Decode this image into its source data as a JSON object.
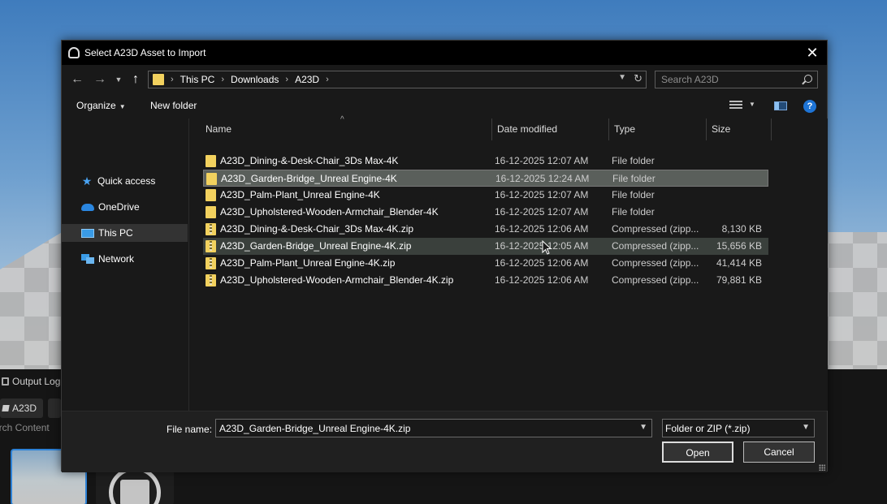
{
  "background": {
    "output_log_tab": "Output Log",
    "content_chip": "A23D",
    "search_hint": "arch Content"
  },
  "dialog": {
    "title": "Select A23D Asset to Import",
    "breadcrumb": [
      "This PC",
      "Downloads",
      "A23D"
    ],
    "search_placeholder": "Search A23D",
    "toolbar": {
      "organize_label": "Organize",
      "new_folder_label": "New folder"
    },
    "nav": [
      {
        "label": "Quick access",
        "icon": "star-icon"
      },
      {
        "label": "OneDrive",
        "icon": "cloud-icon"
      },
      {
        "label": "This PC",
        "icon": "computer-icon"
      },
      {
        "label": "Network",
        "icon": "network-icon"
      }
    ],
    "columns": [
      "Name",
      "Date modified",
      "Type",
      "Size"
    ],
    "files": [
      {
        "name": "A23D_Dining-&-Desk-Chair_3Ds Max-4K",
        "date": "16-12-2025 12:07 AM",
        "type": "File folder",
        "size": "",
        "kind": "folder"
      },
      {
        "name": "A23D_Garden-Bridge_Unreal Engine-4K",
        "date": "16-12-2025 12:24 AM",
        "type": "File folder",
        "size": "",
        "kind": "folder"
      },
      {
        "name": "A23D_Palm-Plant_Unreal Engine-4K",
        "date": "16-12-2025 12:07 AM",
        "type": "File folder",
        "size": "",
        "kind": "folder"
      },
      {
        "name": "A23D_Upholstered-Wooden-Armchair_Blender-4K",
        "date": "16-12-2025 12:07 AM",
        "type": "File folder",
        "size": "",
        "kind": "folder"
      },
      {
        "name": "A23D_Dining-&-Desk-Chair_3Ds Max-4K.zip",
        "date": "16-12-2025 12:06 AM",
        "type": "Compressed (zipp...",
        "size": "8,130 KB",
        "kind": "zip"
      },
      {
        "name": "A23D_Garden-Bridge_Unreal Engine-4K.zip",
        "date": "16-12-2025 12:05 AM",
        "type": "Compressed (zipp...",
        "size": "15,656 KB",
        "kind": "zip"
      },
      {
        "name": "A23D_Palm-Plant_Unreal Engine-4K.zip",
        "date": "16-12-2025 12:06 AM",
        "type": "Compressed (zipp...",
        "size": "41,414 KB",
        "kind": "zip"
      },
      {
        "name": "A23D_Upholstered-Wooden-Armchair_Blender-4K.zip",
        "date": "16-12-2025 12:06 AM",
        "type": "Compressed (zipp...",
        "size": "79,881 KB",
        "kind": "zip"
      }
    ],
    "selected_index": 1,
    "hover_index": 5,
    "file_name_label": "File name:",
    "file_name_value": "A23D_Garden-Bridge_Unreal Engine-4K.zip",
    "filter_value": "Folder or ZIP (*.zip)",
    "open_label": "Open",
    "cancel_label": "Cancel"
  },
  "colors": {
    "folder": "#f2d15e",
    "accent": "#1e74d6",
    "selection": "#5a5f5b"
  }
}
